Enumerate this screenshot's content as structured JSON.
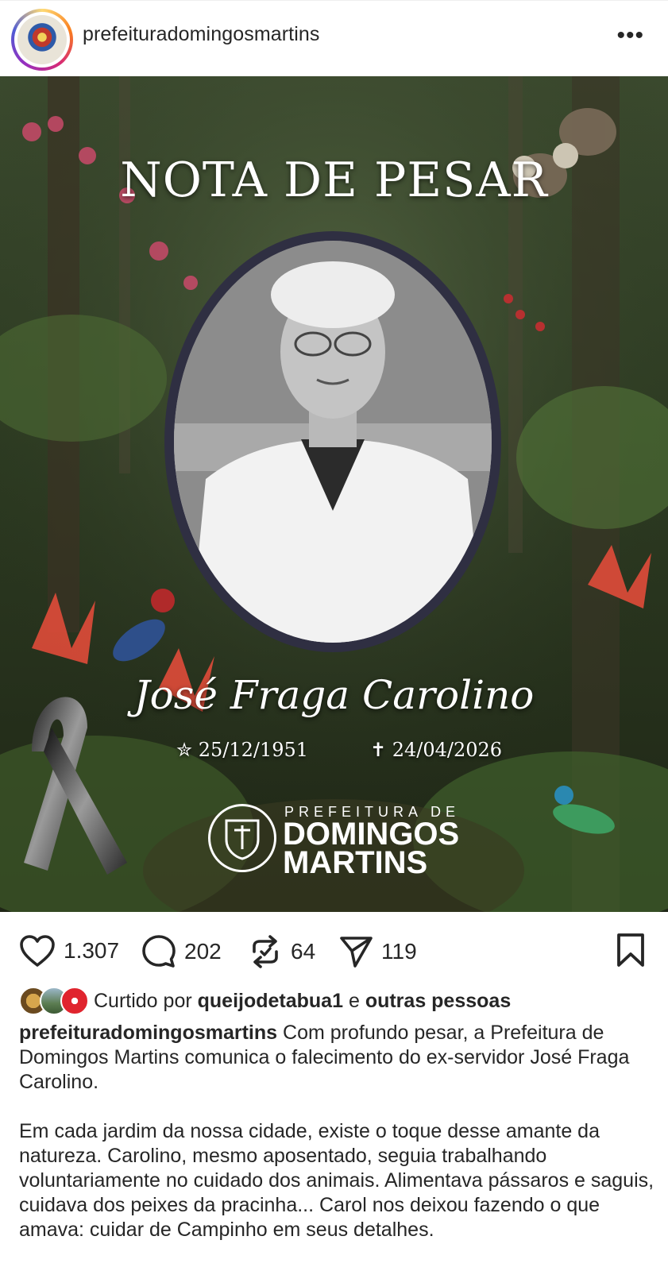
{
  "header": {
    "username": "prefeituradomingosmartins",
    "more_icon": "ellipsis-icon",
    "more_label": "•••"
  },
  "post": {
    "title": "NOTA DE PESAR",
    "name": "José Fraga Carolino",
    "birth": "✮ 25/12/1951",
    "death": "✝ 24/04/2026",
    "logo_top": "PREFEITURA DE",
    "logo_line1": "DOMINGOS",
    "logo_line2": "MARTINS"
  },
  "actions": {
    "likes": "1.307",
    "comments": "202",
    "reposts": "64",
    "shares": "119"
  },
  "liked_by": {
    "prefix": "Curtido por",
    "user": "queijodetabua1",
    "conj": "e",
    "others": "outras pessoas"
  },
  "caption": {
    "user": "prefeituradomingosmartins",
    "text1": " Com profundo pesar, a Prefeitura de Domingos Martins comunica o falecimento do ex-servidor José Fraga Carolino.",
    "text2": "Em cada jardim da nossa cidade, existe o toque desse amante da natureza. Carolino, mesmo aposentado, seguia trabalhando voluntariamente no cuidado dos animais. Alimentava pássaros e saguis, cuidava dos peixes da pracinha... Carol nos deixou fazendo o que amava: cuidar de Campinho em seus detalhes."
  },
  "colors": {
    "text": "#262626",
    "frame": "#2f2f42",
    "forest_dark": "#1f2a17",
    "forest_mid": "#3d4f2a"
  }
}
